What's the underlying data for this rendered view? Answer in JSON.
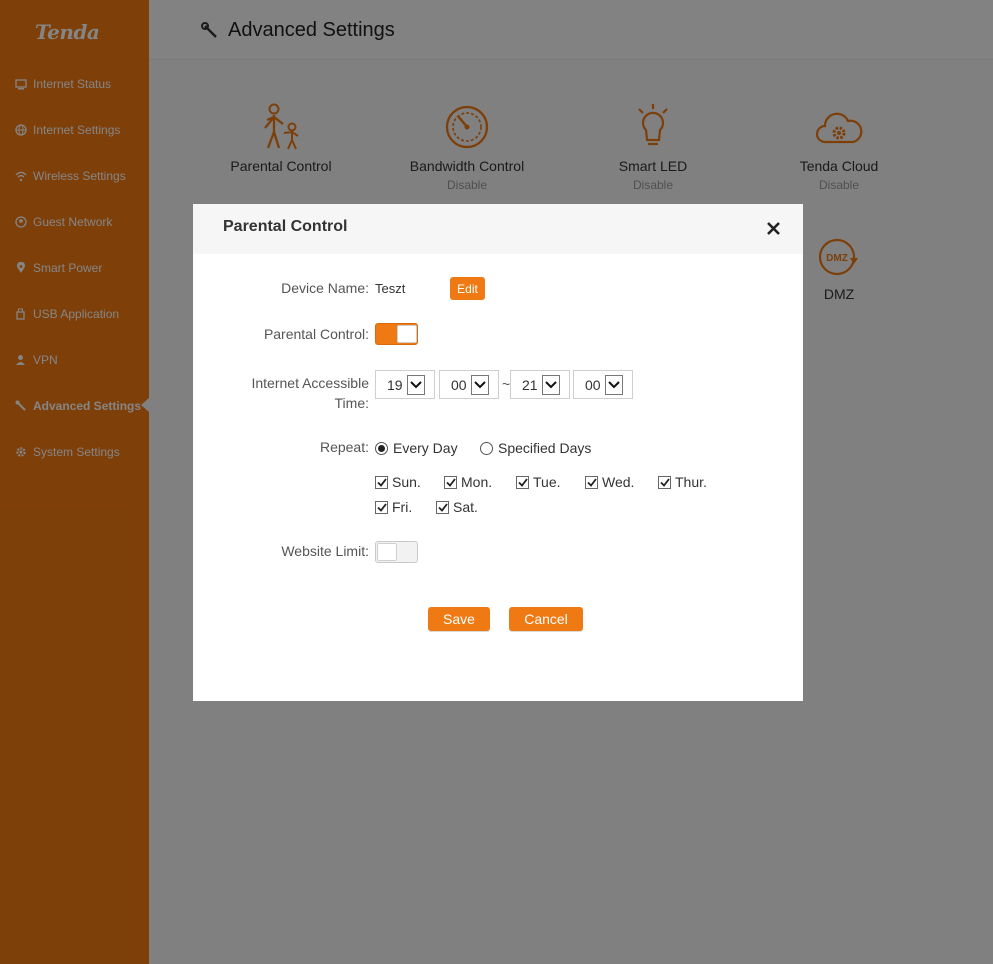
{
  "brand": {
    "logo": "Tenda",
    "accent": "#ef7a13"
  },
  "sidebar": {
    "items": [
      {
        "label": "Internet Status",
        "icon": "monitor-icon"
      },
      {
        "label": "Internet Settings",
        "icon": "globe-icon"
      },
      {
        "label": "Wireless Settings",
        "icon": "wifi-icon"
      },
      {
        "label": "Guest Network",
        "icon": "guest-icon"
      },
      {
        "label": "Smart Power",
        "icon": "location-icon"
      },
      {
        "label": "USB Application",
        "icon": "usb-icon"
      },
      {
        "label": "VPN",
        "icon": "user-icon"
      },
      {
        "label": "Advanced Settings",
        "icon": "wrench-icon",
        "active": true
      },
      {
        "label": "System Settings",
        "icon": "gear-icon"
      }
    ]
  },
  "header": {
    "title": "Advanced Settings"
  },
  "tiles": [
    {
      "name": "Parental Control",
      "status": ""
    },
    {
      "name": "Bandwidth Control",
      "status": "Disable"
    },
    {
      "name": "Smart LED",
      "status": "Disable"
    },
    {
      "name": "Tenda Cloud",
      "status": "Disable"
    },
    {
      "name": "DMZ",
      "status": "",
      "badge": "DMZ"
    }
  ],
  "modal": {
    "title": "Parental Control",
    "device_name_label": "Device Name:",
    "device_name": "Teszt",
    "edit_label": "Edit",
    "parental_control_label": "Parental Control:",
    "parental_control_enabled": true,
    "time_label_1": "Internet Accessible",
    "time_label_2": "Time:",
    "start_hour": "19",
    "start_minute": "00",
    "separator": "~",
    "end_hour": "21",
    "end_minute": "00",
    "repeat_label": "Repeat:",
    "repeat_options": [
      "Every Day",
      "Specified Days"
    ],
    "repeat_selected": "Every Day",
    "days": [
      "Sun.",
      "Mon.",
      "Tue.",
      "Wed.",
      "Thur.",
      "Fri.",
      "Sat."
    ],
    "days_checked": [
      true,
      true,
      true,
      true,
      true,
      true,
      true
    ],
    "website_limit_label": "Website Limit:",
    "website_limit_enabled": false,
    "save_label": "Save",
    "cancel_label": "Cancel"
  }
}
